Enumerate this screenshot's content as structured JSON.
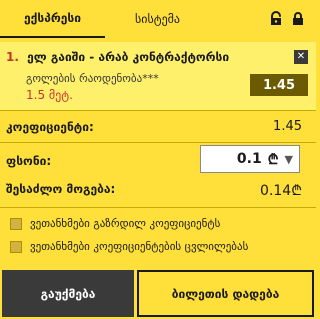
{
  "tabs": {
    "express": "ექსპრესი",
    "system": "სისტემა"
  },
  "bet": {
    "number": "1.",
    "event": "ელ გაიში - არაბ კონტრაქტორსი",
    "market": "გოლების რაოდენობა***",
    "stake": "1.5 მეტ.",
    "odds": "1.45"
  },
  "coefficient": {
    "label": "კოეფიციენტი:",
    "value": "1.45"
  },
  "stake": {
    "label": "ფსონი:",
    "value": "0.1"
  },
  "possible_win": {
    "label": "შესაძლო მოგება:",
    "value": "0.14"
  },
  "options": [
    {
      "label": "ვეთანხმები გაზრდილ კოეფიციენტს"
    },
    {
      "label": "ვეთანხმები კოეფიციენტების ცვლილებას"
    }
  ],
  "buttons": {
    "cancel": "გაუქმება",
    "place": "ბილეთის დადება"
  },
  "icons": {
    "lock_open": "lock-open-icon",
    "lock_closed": "lock-icon",
    "currency": "lari-icon",
    "dropdown": "chevron-down-icon",
    "close": "close-icon"
  },
  "colors": {
    "background": "#ffe03a",
    "bet_panel": "#fff06b",
    "odds_badge": "#6b5a00",
    "accent_red": "#c9342a",
    "cancel_button": "#3a3a3a"
  }
}
